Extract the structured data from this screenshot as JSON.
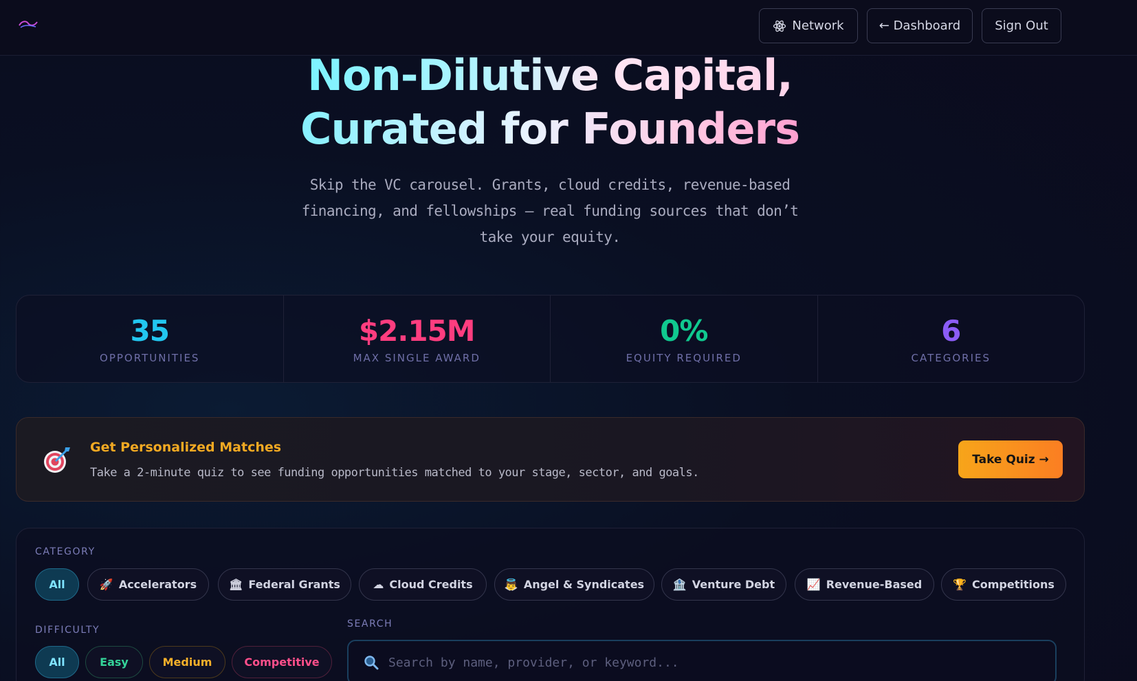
{
  "nav": {
    "network_label": "Network",
    "dashboard_label": "← Dashboard",
    "signout_label": "Sign Out"
  },
  "hero": {
    "title_line1": "Non-Dilutive Capital,",
    "title_line2": "Curated for Founders",
    "subtitle": "Skip the VC carousel. Grants, cloud credits, revenue-based financing, and fellowships — real funding sources that don’t take your equity."
  },
  "stats": [
    {
      "value": "35",
      "label": "OPPORTUNITIES",
      "color": "#22c7f0"
    },
    {
      "value": "$2.15M",
      "label": "MAX SINGLE AWARD",
      "color": "#ff3d7f"
    },
    {
      "value": "0%",
      "label": "EQUITY REQUIRED",
      "color": "#10c98f"
    },
    {
      "value": "6",
      "label": "CATEGORIES",
      "color": "#8b5cf6"
    }
  ],
  "quiz": {
    "icon": "target-icon",
    "title": "Get Personalized Matches",
    "description": "Take a 2-minute quiz to see funding opportunities matched to your stage, sector, and goals.",
    "button_label": "Take Quiz →"
  },
  "filters": {
    "category_label": "CATEGORY",
    "categories": [
      {
        "label": "All",
        "icon": ""
      },
      {
        "label": "Accelerators",
        "icon": "🚀"
      },
      {
        "label": "Federal Grants",
        "icon": "🏛"
      },
      {
        "label": "Cloud Credits",
        "icon": "☁"
      },
      {
        "label": "Angel & Syndicates",
        "icon": "👼"
      },
      {
        "label": "Venture Debt",
        "icon": "🏦"
      },
      {
        "label": "Revenue-Based",
        "icon": "📈"
      },
      {
        "label": "Competitions",
        "icon": "🏆"
      }
    ],
    "difficulty_label": "DIFFICULTY",
    "difficulties": [
      {
        "label": "All"
      },
      {
        "label": "Easy"
      },
      {
        "label": "Medium"
      },
      {
        "label": "Competitive"
      }
    ],
    "search_label": "SEARCH",
    "search_placeholder": "Search by name, provider, or keyword...",
    "search_value": ""
  },
  "colors": {
    "accent_cyan": "#22c7f0",
    "accent_orange": "#f7a51a",
    "brand_pink": "#ff3d7f"
  }
}
